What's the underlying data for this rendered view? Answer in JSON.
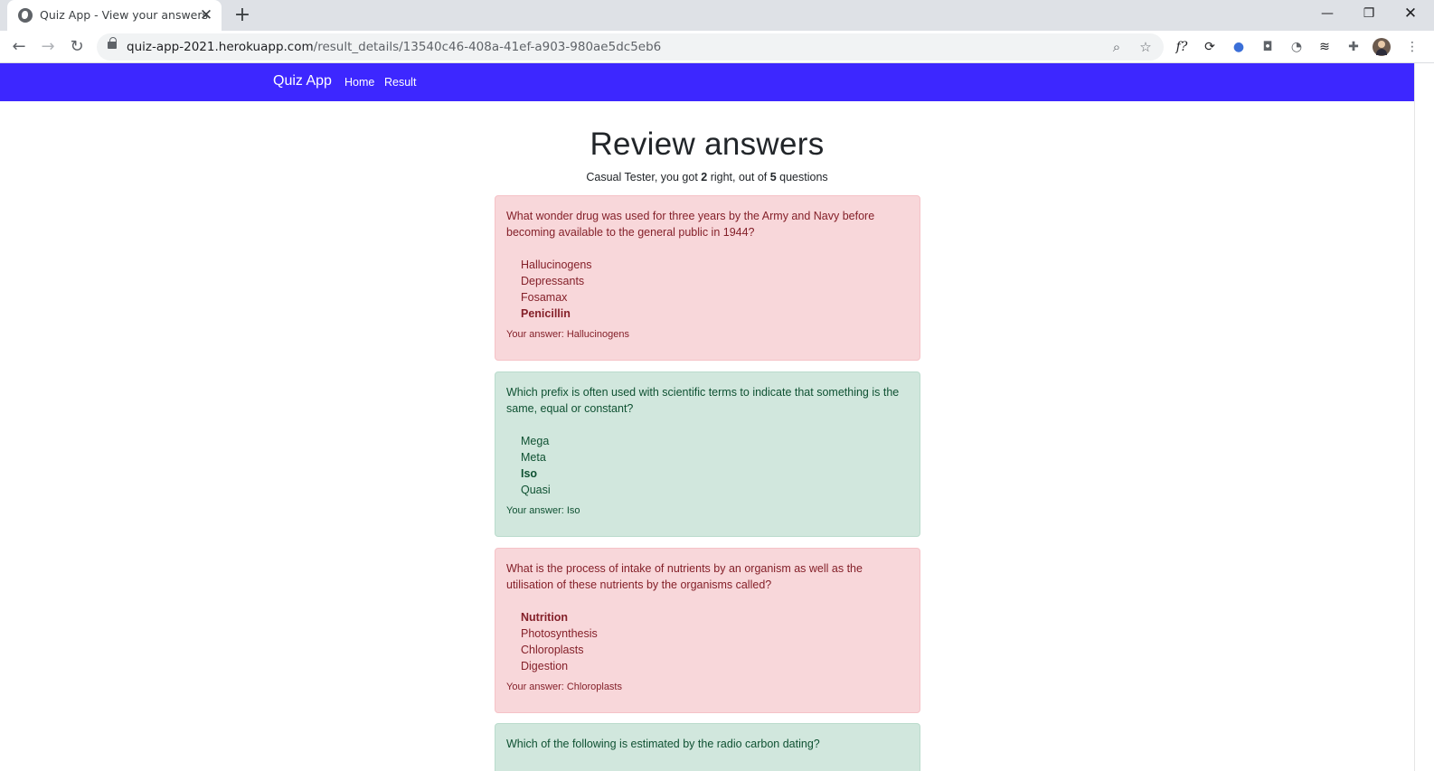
{
  "browser": {
    "tab_title": "Quiz App - View your answers",
    "url_host": "quiz-app-2021.herokuapp.com",
    "url_path": "/result_details/13540c46-408a-41ef-a903-980ae5dc5eb6",
    "icons": {
      "back": "back-arrow-icon",
      "forward": "forward-arrow-icon",
      "reload": "reload-icon",
      "lock": "lock-icon",
      "zoom": "zoom-icon",
      "bookmark": "star-icon",
      "extensions": "puzzle-icon",
      "menu": "kebab-menu-icon"
    }
  },
  "navbar": {
    "brand": "Quiz App",
    "links": [
      "Home",
      "Result"
    ],
    "color": "#3d27ff"
  },
  "main": {
    "title": "Review answers",
    "summary": {
      "name_prefix": "Casual Tester, you got ",
      "correct_count": "2",
      "middle": " right, out of ",
      "total": "5",
      "suffix": " questions"
    },
    "status_colors": {
      "wrong_bg": "#f8d7da",
      "right_bg": "#d1e7dd"
    },
    "questions": [
      {
        "status": "wrong",
        "question": "What wonder drug was used for three years by the Army and Navy before becoming available to the general public in 1944?",
        "options": [
          {
            "text": "Hallucinogens",
            "correct": false
          },
          {
            "text": "Depressants",
            "correct": false
          },
          {
            "text": "Fosamax",
            "correct": false
          },
          {
            "text": "Penicillin",
            "correct": true
          }
        ],
        "your_answer": "Your answer: Hallucinogens"
      },
      {
        "status": "right",
        "question": "Which prefix is often used with scientific terms to indicate that something is the same, equal or constant?",
        "options": [
          {
            "text": "Mega",
            "correct": false
          },
          {
            "text": "Meta",
            "correct": false
          },
          {
            "text": "Iso",
            "correct": true
          },
          {
            "text": "Quasi",
            "correct": false
          }
        ],
        "your_answer": "Your answer: Iso"
      },
      {
        "status": "wrong",
        "question": "What is the process of intake of nutrients by an organism as well as the utilisation of these nutrients by the organisms called?",
        "options": [
          {
            "text": "Nutrition",
            "correct": true
          },
          {
            "text": "Photosynthesis",
            "correct": false
          },
          {
            "text": "Chloroplasts",
            "correct": false
          },
          {
            "text": "Digestion",
            "correct": false
          }
        ],
        "your_answer": "Your answer: Chloroplasts"
      },
      {
        "status": "right",
        "question": "Which of the following is estimated by the radio carbon dating?",
        "options": [],
        "your_answer": ""
      }
    ]
  }
}
